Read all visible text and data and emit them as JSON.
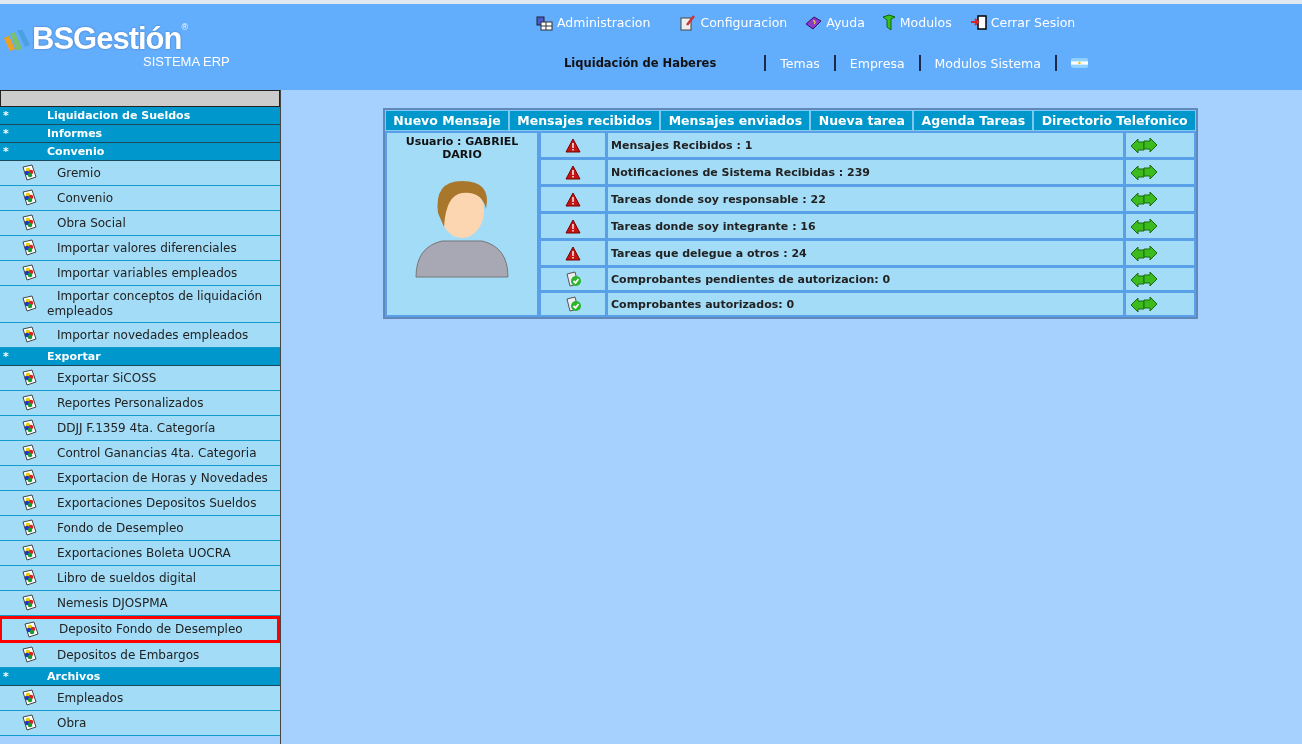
{
  "logo": {
    "name": "BSGestión",
    "mark": "®",
    "subtitle": "SISTEMA ERP"
  },
  "top_menu": [
    {
      "kind": "admin",
      "label": "Administracion"
    },
    {
      "kind": "config",
      "label": "Configuracion"
    },
    {
      "kind": "help",
      "label": "Ayuda"
    },
    {
      "kind": "modules",
      "label": "Modulos"
    },
    {
      "kind": "logout",
      "label": "Cerrar Sesion"
    }
  ],
  "module_title": "Liquidación de Haberes",
  "sub_menu": [
    "Temas",
    "Empresa",
    "Modulos Sistema"
  ],
  "sidebar": {
    "sections": [
      {
        "title": "Liquidacion de Sueldos",
        "marker": "*"
      },
      {
        "title": "Informes",
        "marker": "*"
      },
      {
        "title": "Convenio",
        "marker": "*",
        "items": [
          {
            "label": "Gremio",
            "highlighted": false
          },
          {
            "label": "Convenio",
            "highlighted": false
          },
          {
            "label": "Obra Social",
            "highlighted": false
          },
          {
            "label": "Importar valores diferenciales",
            "highlighted": false
          },
          {
            "label": "Importar variables empleados",
            "highlighted": false
          },
          {
            "label": "Importar conceptos de liquidación empleados",
            "highlighted": false
          },
          {
            "label": "Importar novedades empleados",
            "highlighted": false
          }
        ]
      },
      {
        "title": "Exportar",
        "marker": "*",
        "items": [
          {
            "label": "Exportar SiCOSS",
            "highlighted": false
          },
          {
            "label": "Reportes Personalizados",
            "highlighted": false
          },
          {
            "label": "DDJJ F.1359 4ta. Categoría",
            "highlighted": false
          },
          {
            "label": "Control Ganancias 4ta. Categoria",
            "highlighted": false
          },
          {
            "label": "Exportacion de Horas y Novedades",
            "highlighted": false
          },
          {
            "label": "Exportaciones Depositos Sueldos",
            "highlighted": false
          },
          {
            "label": "Fondo de Desempleo",
            "highlighted": false
          },
          {
            "label": "Exportaciones Boleta UOCRA",
            "highlighted": false
          },
          {
            "label": "Libro de sueldos digital",
            "highlighted": false
          },
          {
            "label": "Nemesis DJOSPMA",
            "highlighted": false
          },
          {
            "label": "Deposito Fondo de Desempleo",
            "highlighted": true
          },
          {
            "label": "Depositos de Embargos",
            "highlighted": false
          }
        ]
      },
      {
        "title": "Archivos",
        "marker": "*",
        "items": [
          {
            "label": "Empleados",
            "highlighted": false
          },
          {
            "label": "Obra",
            "highlighted": false
          }
        ]
      }
    ]
  },
  "panel": {
    "tabs": [
      "Nuevo Mensaje",
      "Mensajes recibidos",
      "Mensajes enviados",
      "Nueva tarea",
      "Agenda Tareas",
      "Directorio Telefonico"
    ],
    "user": "Usuario : GABRIEL DARIO",
    "rows": [
      {
        "kind": "warning",
        "text": "Mensajes Recibidos : 1"
      },
      {
        "kind": "warning",
        "text": "Notificaciones de Sistema Recibidas : 239"
      },
      {
        "kind": "warning",
        "text": "Tareas donde soy responsable : 22"
      },
      {
        "kind": "warning",
        "text": "Tareas donde soy integrante : 16"
      },
      {
        "kind": "warning",
        "text": "Tareas que delegue a otros : 24"
      },
      {
        "kind": "ok",
        "text": "Comprobantes pendientes de autorizacion: 0"
      },
      {
        "kind": "ok",
        "text": "Comprobantes autorizados: 0"
      }
    ]
  }
}
